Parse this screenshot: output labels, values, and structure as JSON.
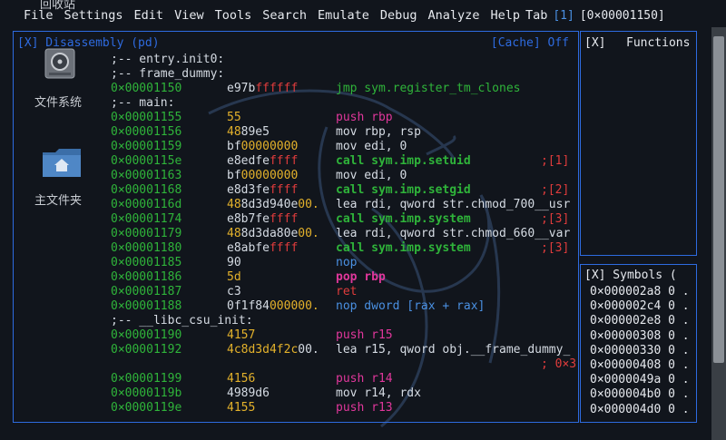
{
  "menubar": {
    "items": [
      "File",
      "Settings",
      "Edit",
      "View",
      "Tools",
      "Search",
      "Emulate",
      "Debug",
      "Analyze",
      "Help",
      "Tab"
    ],
    "tab_index": "[1]",
    "current_address": "[0×00001150]"
  },
  "desktop": {
    "recycle_label": "回收站",
    "filesystem_label": "文件系统",
    "home_label": "主文件夹"
  },
  "disasm_panel": {
    "title": "[X] Disassembly (pd)",
    "cache_label": "[Cache] Off",
    "rows": [
      {
        "type": "label",
        "text": ";-- entry.init0:"
      },
      {
        "type": "label",
        "text": ";-- frame_dummy:"
      },
      {
        "type": "code",
        "addr": "0×00001150",
        "bytes": [
          {
            "t": "e97b",
            "c": "norm"
          },
          {
            "t": "ffffff",
            "c": "red"
          }
        ],
        "op": "jmp sym.register_tm_clones",
        "opc": "green",
        "bold": false,
        "cmt": ""
      },
      {
        "type": "label",
        "text": ";-- main:"
      },
      {
        "type": "code",
        "addr": "0×00001155",
        "bytes": [
          {
            "t": "55",
            "c": "yel"
          }
        ],
        "op": "push rbp",
        "opc": "mag",
        "bold": false,
        "cmt": ""
      },
      {
        "type": "code",
        "addr": "0×00001156",
        "bytes": [
          {
            "t": "48",
            "c": "yel"
          },
          {
            "t": "89e5",
            "c": "norm"
          }
        ],
        "op": "mov rbp, rsp",
        "opc": "norm",
        "bold": false,
        "cmt": ""
      },
      {
        "type": "code",
        "addr": "0×00001159",
        "bytes": [
          {
            "t": "bf",
            "c": "norm"
          },
          {
            "t": "00000000",
            "c": "yel"
          }
        ],
        "op": "mov edi, 0",
        "opc": "norm",
        "bold": false,
        "cmt": ""
      },
      {
        "type": "code",
        "addr": "0×0000115e",
        "bytes": [
          {
            "t": "e8edfe",
            "c": "norm"
          },
          {
            "t": "ffff",
            "c": "red"
          }
        ],
        "op": "call sym.imp.setuid",
        "opc": "green",
        "bold": true,
        "cmt": ";[1]"
      },
      {
        "type": "code",
        "addr": "0×00001163",
        "bytes": [
          {
            "t": "bf",
            "c": "norm"
          },
          {
            "t": "00000000",
            "c": "yel"
          }
        ],
        "op": "mov edi, 0",
        "opc": "norm",
        "bold": false,
        "cmt": ""
      },
      {
        "type": "code",
        "addr": "0×00001168",
        "bytes": [
          {
            "t": "e8d3fe",
            "c": "norm"
          },
          {
            "t": "ffff",
            "c": "red"
          }
        ],
        "op": "call sym.imp.setgid",
        "opc": "green",
        "bold": true,
        "cmt": ";[2]"
      },
      {
        "type": "code",
        "addr": "0×0000116d",
        "bytes": [
          {
            "t": "48",
            "c": "yel"
          },
          {
            "t": "8d3d940e",
            "c": "norm"
          },
          {
            "t": "00.",
            "c": "yel"
          }
        ],
        "op": "lea rdi, qword str.chmod_700__usr",
        "opc": "norm",
        "bold": false,
        "cmt": ""
      },
      {
        "type": "code",
        "addr": "0×00001174",
        "bytes": [
          {
            "t": "e8b7fe",
            "c": "norm"
          },
          {
            "t": "ffff",
            "c": "red"
          }
        ],
        "op": "call sym.imp.system",
        "opc": "green",
        "bold": true,
        "cmt": ";[3]"
      },
      {
        "type": "code",
        "addr": "0×00001179",
        "bytes": [
          {
            "t": "48",
            "c": "yel"
          },
          {
            "t": "8d3da80e",
            "c": "norm"
          },
          {
            "t": "00.",
            "c": "yel"
          }
        ],
        "op": "lea rdi, qword str.chmod_660__var",
        "opc": "norm",
        "bold": false,
        "cmt": ""
      },
      {
        "type": "code",
        "addr": "0×00001180",
        "bytes": [
          {
            "t": "e8abfe",
            "c": "norm"
          },
          {
            "t": "ffff",
            "c": "red"
          }
        ],
        "op": "call sym.imp.system",
        "opc": "green",
        "bold": true,
        "cmt": ";[3]"
      },
      {
        "type": "code",
        "addr": "0×00001185",
        "bytes": [
          {
            "t": "90",
            "c": "norm"
          }
        ],
        "op": "nop",
        "opc": "blue",
        "bold": false,
        "cmt": ""
      },
      {
        "type": "code",
        "addr": "0×00001186",
        "bytes": [
          {
            "t": "5d",
            "c": "yel"
          }
        ],
        "op": "pop rbp",
        "opc": "mag",
        "bold": true,
        "cmt": ""
      },
      {
        "type": "code",
        "addr": "0×00001187",
        "bytes": [
          {
            "t": "c3",
            "c": "norm"
          }
        ],
        "op": "ret",
        "opc": "red",
        "bold": false,
        "cmt": ""
      },
      {
        "type": "code",
        "addr": "0×00001188",
        "bytes": [
          {
            "t": "0f1f84",
            "c": "norm"
          },
          {
            "t": "000000.",
            "c": "yel"
          }
        ],
        "op": "nop dword [rax + rax]",
        "opc": "blue",
        "bold": false,
        "cmt": ""
      },
      {
        "type": "label",
        "text": ";-- __libc_csu_init:"
      },
      {
        "type": "code",
        "addr": "0×00001190",
        "bytes": [
          {
            "t": "4157",
            "c": "yel"
          }
        ],
        "op": "push r15",
        "opc": "mag",
        "bold": false,
        "cmt": ""
      },
      {
        "type": "code",
        "addr": "0×00001192",
        "bytes": [
          {
            "t": "4c8d3d4f2c",
            "c": "yel"
          },
          {
            "t": "00.",
            "c": "norm"
          }
        ],
        "op": "lea r15, qword obj.__frame_dummy_",
        "opc": "norm",
        "bold": false,
        "cmt": ""
      },
      {
        "type": "comment",
        "cmt": "; 0×3"
      },
      {
        "type": "code",
        "addr": "0×00001199",
        "bytes": [
          {
            "t": "4156",
            "c": "yel"
          }
        ],
        "op": "push r14",
        "opc": "mag",
        "bold": false,
        "cmt": ""
      },
      {
        "type": "code",
        "addr": "0×0000119b",
        "bytes": [
          {
            "t": "4989d6",
            "c": "norm"
          }
        ],
        "op": "mov r14, rdx",
        "opc": "norm",
        "bold": false,
        "cmt": ""
      },
      {
        "type": "code",
        "addr": "0×0000119e",
        "bytes": [
          {
            "t": "4155",
            "c": "yel"
          }
        ],
        "op": "push r13",
        "opc": "mag",
        "bold": false,
        "cmt": ""
      }
    ]
  },
  "functions_panel": {
    "close": "[X]",
    "title": "Functions"
  },
  "symbols_panel": {
    "title": "[X]   Symbols (",
    "rows": [
      "0×000002a8 0 .",
      "0×000002c4 0 .",
      "0×000002e8 0 .",
      "0×00000308 0 .",
      "0×00000330 0 .",
      "0×00000408 0 .",
      "0×0000049a 0 .",
      "0×000004b0 0 .",
      "0×000004d0 0 ."
    ]
  },
  "colors": {
    "panel_border": "#2e6be0",
    "address": "#2fb43a",
    "yellow": "#e3b12b",
    "red": "#e03c3c",
    "magenta": "#e0379b",
    "blue": "#4a90e2"
  }
}
